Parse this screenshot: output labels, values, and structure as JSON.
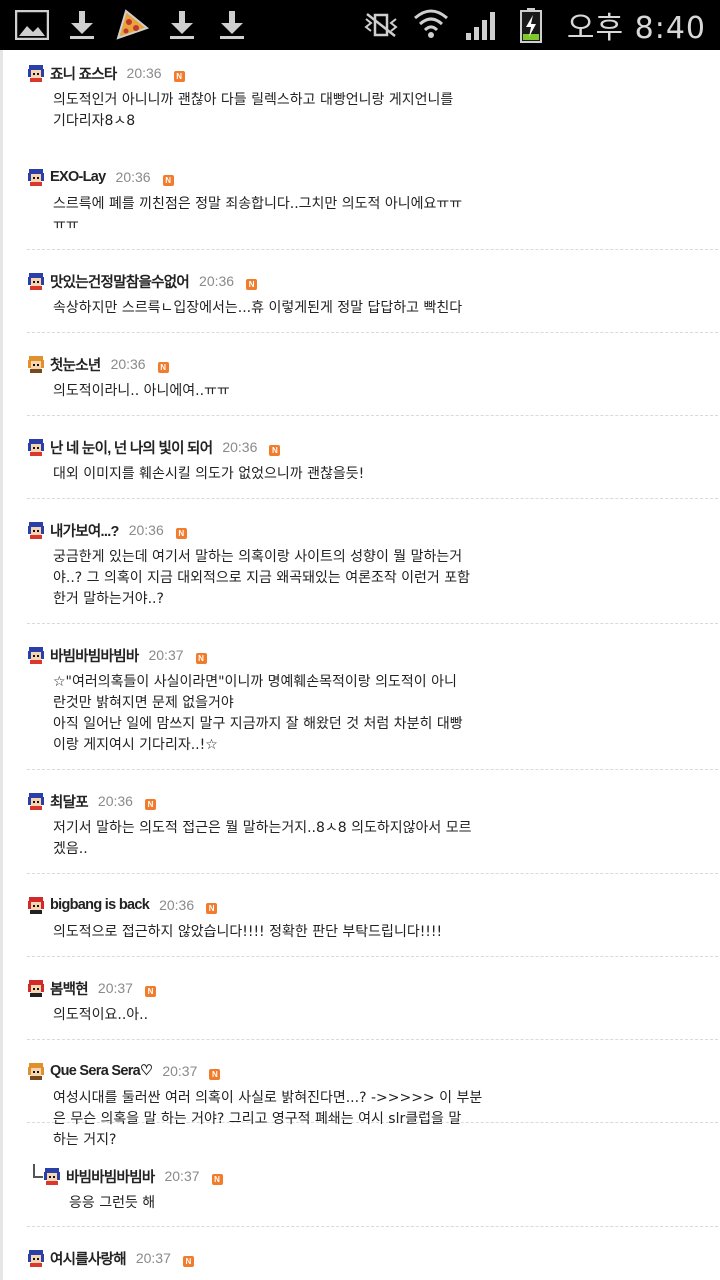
{
  "status_bar": {
    "time": "오후 8:40",
    "left_icons": [
      "gallery-icon",
      "download-icon",
      "pizza-icon",
      "download-icon",
      "download-icon"
    ],
    "right_icons": [
      "vibrate-mute-icon",
      "wifi-icon",
      "signal-icon",
      "battery-charging-icon"
    ],
    "colors": {
      "background": "#000000",
      "icon": "#cfcfcf",
      "battery_charge": "#7ec82a"
    }
  },
  "comments": [
    {
      "name": "죠니 죠스타",
      "time": "20:36",
      "badge": "N",
      "text": "의도적인거 아니니까 괜찮아 다들 릴렉스하고 대빵언니랑 게지언니를\n기다리자8ㅅ8",
      "avatar": "blue-hair-avatar"
    },
    {
      "name": "EXO-Lay",
      "time": "20:36",
      "badge": "N",
      "text": "스르륵에 폐를 끼친점은 정말 죄송합니다..그치만 의도적 아니에요ㅠㅠ\nㅠㅠ",
      "avatar": "blue-hair-avatar"
    },
    {
      "name": "맛있는건정말참을수없어",
      "time": "20:36",
      "badge": "N",
      "text": "속상하지만 스르륵ㄴ입장에서는...휴 이렇게된게 정말 답답하고 빡친다",
      "avatar": "blue-hair-avatar"
    },
    {
      "name": "첫눈소년",
      "time": "20:36",
      "badge": "N",
      "text": "의도적이라니.. 아니에여..ㅠㅠ",
      "avatar": "orange-hair-avatar"
    },
    {
      "name": "난 네 눈이, 넌 나의 빛이 되어",
      "time": "20:36",
      "badge": "N",
      "text": "대외 이미지를 훼손시킬 의도가 없었으니까 괜찮을듯!",
      "avatar": "blue-hair-avatar"
    },
    {
      "name": "내가보여...?",
      "time": "20:36",
      "badge": "N",
      "text": "궁금한게 있는데 여기서 말하는 의혹이랑 사이트의 성향이 뭘 말하는거\n야..? 그 의혹이 지금 대외적으로 지금 왜곡돼있는 여론조작 이런거 포함\n한거 말하는거야..?",
      "avatar": "blue-hair-avatar"
    },
    {
      "name": "바빔바빔바빔바",
      "time": "20:37",
      "badge": "N",
      "text": "☆\"여러의혹들이 사실이라면\"이니까 명예훼손목적이랑 의도적이 아니\n란것만 밝혀지면 문제 없을거야\n아직 일어난 일에 맘쓰지 말구 지금까지 잘 해왔던 것 처럼 차분히 대빵\n이랑 게지여시 기다리자..!☆",
      "avatar": "blue-hair-avatar"
    },
    {
      "name": "최달포",
      "time": "20:36",
      "badge": "N",
      "text": "저기서 말하는 의도적 접근은 뭘 말하는거지..8ㅅ8 의도하지않아서 모르\n겠음..",
      "avatar": "blue-hair-avatar"
    },
    {
      "name": "bigbang is back",
      "time": "20:36",
      "badge": "N",
      "text": "의도적으로 접근하지 않았습니다!!!! 정확한 판단 부탁드립니다!!!!",
      "avatar": "red-hair-avatar"
    },
    {
      "name": "봄백현",
      "time": "20:37",
      "badge": "N",
      "text": "의도적이요..아..",
      "avatar": "red-hair-avatar"
    },
    {
      "name": "Que Sera Sera♡",
      "time": "20:37",
      "badge": "N",
      "text": "여성시대를 둘러싼 여러 의혹이 사실로 밝혀진다면...? ->>>>> 이 부분\n은 무슨 의혹을 말 하는 거야? 그리고 영구적 폐쇄는 여시 slr클럽을 말\n하는 거지?",
      "avatar": "orange-hair-avatar"
    },
    {
      "name": "바빔바빔바빔바",
      "time": "20:37",
      "badge": "N",
      "text": "응응 그런듯 해",
      "avatar": "blue-hair-avatar",
      "reply": true
    },
    {
      "name": "여시를사랑해",
      "time": "20:37",
      "badge": "N",
      "text": "",
      "avatar": "blue-hair-avatar"
    }
  ]
}
